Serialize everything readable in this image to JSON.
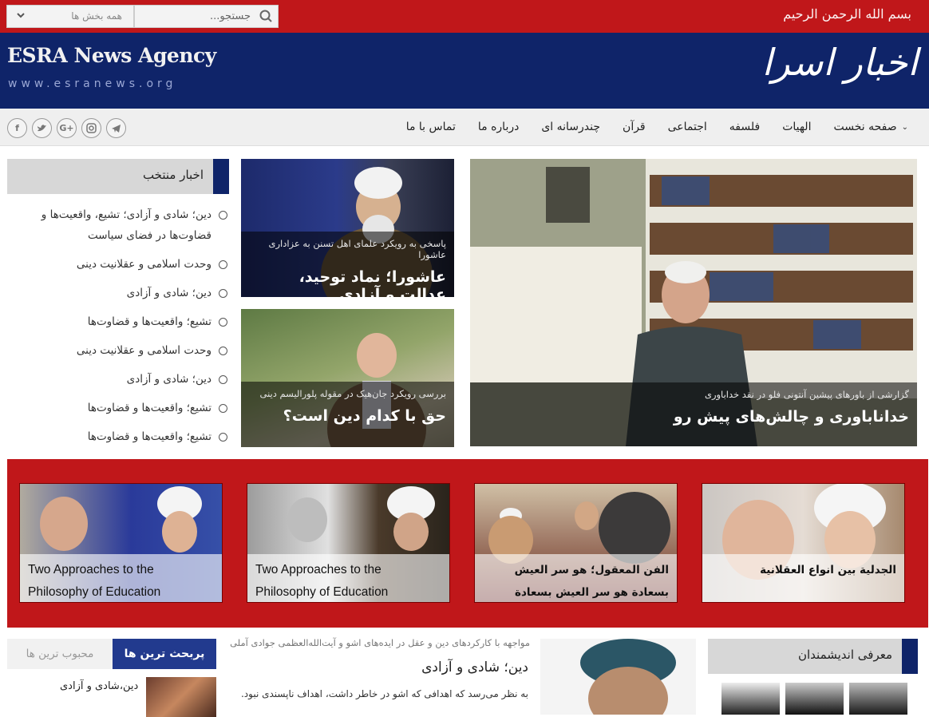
{
  "topbar": {
    "bismillah": "بسم الله الرحمن الرحیم",
    "search_placeholder": "جستجو...",
    "sections_label": "همه بخش ها"
  },
  "header": {
    "brand": "ESRA News Agency",
    "url": "www.esranews.org",
    "logo": "اخبار اسرا"
  },
  "nav": {
    "items": [
      {
        "label": "صفحه نخست",
        "dropdown": true
      },
      {
        "label": "الهیات"
      },
      {
        "label": "فلسفه"
      },
      {
        "label": "اجتماعی"
      },
      {
        "label": "قرآن"
      },
      {
        "label": "چندرسانه ای"
      },
      {
        "label": "درباره ما"
      },
      {
        "label": "تماس با ما"
      }
    ],
    "social": [
      "f",
      "t",
      "G+",
      "ig",
      "tg"
    ]
  },
  "picks": {
    "title": "اخبار منتخب",
    "items": [
      "دین؛ شادی و آزادی؛ تشیع، واقعیت‌ها و قضاوت‌ها در فضای سیاست",
      "وحدت اسلامی و عقلانیت دینی",
      "دین؛ شادی و آزادی",
      "تشیع؛ واقعیت‌ها و قضاوت‌ها",
      "وحدت اسلامی و عقلانیت دینی",
      "دین؛ شادی و آزادی",
      "تشیع؛ واقعیت‌ها و قضاوت‌ها",
      "تشیع؛ واقعیت‌ها و قضاوت‌ها"
    ]
  },
  "featured": {
    "main": {
      "sub": "گزارشی از باورهای پیشین آنتونی فلو در نقد خداباوری",
      "title": "خداناباوری و چالش‌های پیش رو"
    },
    "top": {
      "sub": "پاسخی به رویکرد علمای اهل تسنن به عزاداری عاشورا",
      "title": "عاشورا؛ نماد توحید، عدالت و آزادی"
    },
    "bottom": {
      "sub": "بررسی رویکرد جان‌هیک در مقوله پلورالیسم دینی",
      "title": "حق با کدام دین است؟"
    }
  },
  "cards": [
    {
      "caption": "الجدلیة بین انواع العقلانیة",
      "lang": "ar"
    },
    {
      "caption": "الفن المعقول؛ هو سر العیش بسعادة هو سر العیش بسعادة",
      "lang": "ar"
    },
    {
      "caption": "Two Approaches to the Philosophy of Education",
      "lang": "en"
    },
    {
      "caption": "Two Approaches to the Philosophy of Education",
      "lang": "en"
    }
  ],
  "tabs": {
    "most_read": "پربحث ترین ها",
    "most_popular": "محبوب ترین ها",
    "item": "دین،شادی و آزادی"
  },
  "article": {
    "kicker": "مواجهه با کارکردهای دین و عقل در ایده‌های اشو و آیت‌الله‌العظمی جوادی آملی",
    "title": "دین؛ شادی و آزادی",
    "snippet": "به نظر می‌رسد که اهدافی که اشو در خاطر داشت، اهداف ناپسندی نبود. او به"
  },
  "thinkers": {
    "title": "معرفی اندیشمندان"
  },
  "colors": {
    "red": "#c0171a",
    "navy": "#0f2469",
    "tab_blue": "#223a8e"
  }
}
